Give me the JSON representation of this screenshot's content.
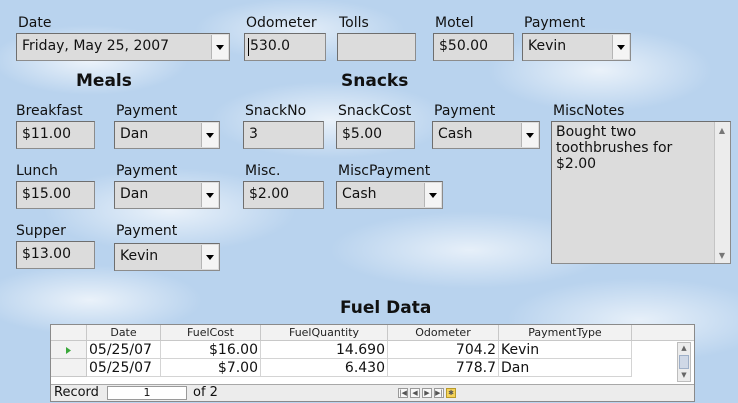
{
  "top": {
    "date": {
      "label": "Date",
      "value": "Friday, May 25, 2007"
    },
    "odometer": {
      "label": "Odometer",
      "value": "530.0"
    },
    "tolls": {
      "label": "Tolls",
      "value": ""
    },
    "motel": {
      "label": "Motel",
      "value": "$50.00"
    },
    "payment": {
      "label": "Payment",
      "value": "Kevin"
    }
  },
  "meals": {
    "header": "Meals",
    "breakfast": {
      "label": "Breakfast",
      "value": "$11.00",
      "payment_label": "Payment",
      "payment": "Dan"
    },
    "lunch": {
      "label": "Lunch",
      "value": "$15.00",
      "payment_label": "Payment",
      "payment": "Dan"
    },
    "supper": {
      "label": "Supper",
      "value": "$13.00",
      "payment_label": "Payment",
      "payment": "Kevin"
    }
  },
  "snacks": {
    "header": "Snacks",
    "snack_no": {
      "label": "SnackNo",
      "value": "3"
    },
    "snack_cost": {
      "label": "SnackCost",
      "value": "$5.00"
    },
    "payment": {
      "label": "Payment",
      "value": "Cash"
    },
    "misc": {
      "label": "Misc.",
      "value": "$2.00"
    },
    "misc_payment": {
      "label": "MiscPayment",
      "value": "Cash"
    }
  },
  "misc_notes": {
    "label": "MiscNotes",
    "value": "Bought two toothbrushes for $2.00"
  },
  "fuel": {
    "header": "Fuel Data",
    "columns": [
      "Date",
      "FuelCost",
      "FuelQuantity",
      "Odometer",
      "PaymentType"
    ],
    "rows": [
      [
        "05/25/07",
        "$16.00",
        "14.690",
        "704.2",
        "Kevin"
      ],
      [
        "05/25/07",
        "$7.00",
        "6.430",
        "778.7",
        "Dan"
      ]
    ],
    "nav": {
      "record_label": "Record",
      "record_value": "1",
      "of_text": "of 2"
    }
  },
  "colors": {
    "background": "#b9d3ee",
    "field": "#dcdcdc",
    "current_row_marker": "#3aa83a"
  }
}
